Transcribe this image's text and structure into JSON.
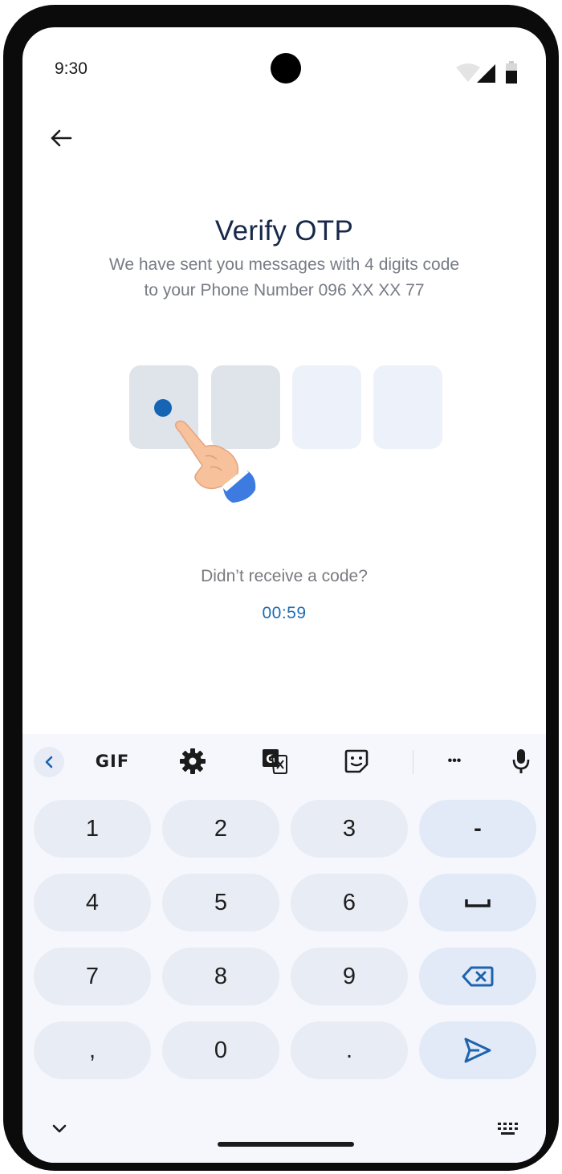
{
  "status_bar": {
    "time": "9:30"
  },
  "header": {
    "back_icon": "arrow-left-icon"
  },
  "main": {
    "title": "Verify OTP",
    "subtitle_line1": "We have sent you messages with 4 digits code",
    "subtitle_line2": "to your Phone Number 096 XX XX 77",
    "otp_length": 4,
    "otp_filled": 1,
    "resend_question": "Didn’t receive a code?",
    "timer": "00:59"
  },
  "keyboard": {
    "toolbar": {
      "collapse_icon": "chevron-left-icon",
      "gif_label": "GIF",
      "settings_icon": "gear-icon",
      "translate_icon": "translate-icon",
      "sticker_icon": "sticker-icon",
      "more_label": "•••",
      "mic_icon": "microphone-icon"
    },
    "keys": {
      "k1": "1",
      "k2": "2",
      "k3": "3",
      "dash": "-",
      "k4": "4",
      "k5": "5",
      "k6": "6",
      "k7": "7",
      "k8": "8",
      "k9": "9",
      "comma": ",",
      "k0": "0",
      "period": "."
    },
    "space_icon": "space-icon",
    "backspace_icon": "backspace-icon",
    "send_icon": "send-icon",
    "hide_keyboard_icon": "chevron-down-icon",
    "keyboard_switch_icon": "keyboard-icon"
  },
  "colors": {
    "accent": "#1565b4",
    "title": "#17284a",
    "otp_active": "#dfe3ea",
    "otp_inactive": "#edf1f9"
  }
}
